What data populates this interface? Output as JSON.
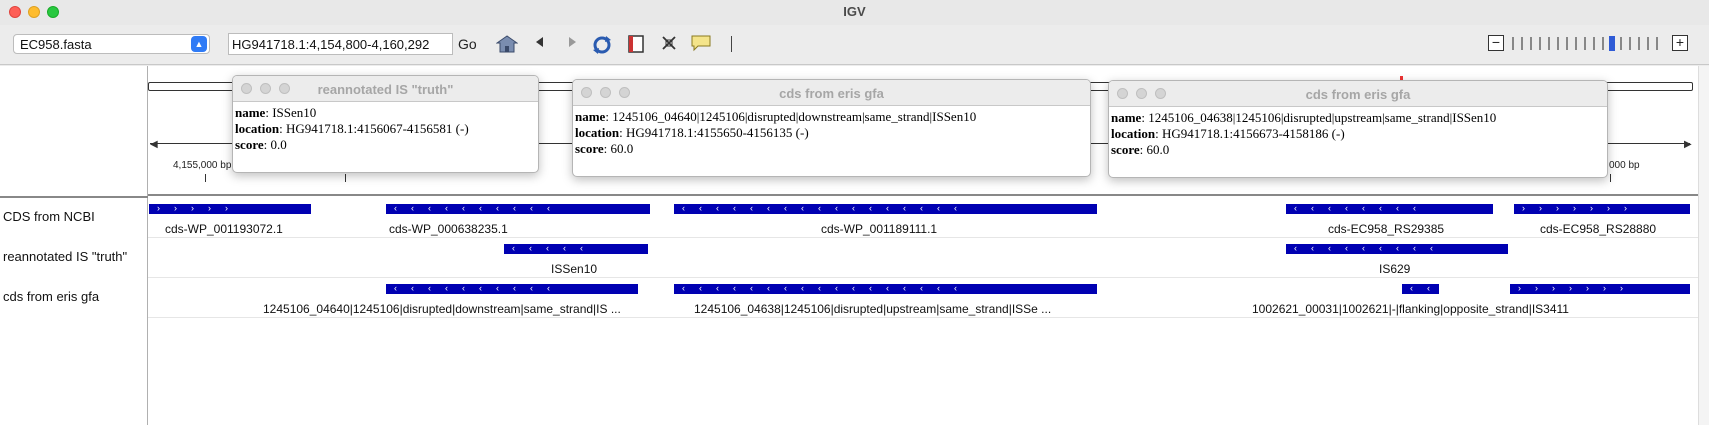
{
  "window": {
    "title": "IGV"
  },
  "toolbar": {
    "genome": "EC958.fasta",
    "locus": "HG941718.1:4,154,800-4,160,292",
    "go_label": "Go",
    "icons": [
      "home-icon",
      "back-icon",
      "forward-icon",
      "refresh-icon",
      "ruler-icon",
      "resize-icon",
      "popup-text-icon"
    ]
  },
  "ruler": {
    "left_label": "4,155,000 bp",
    "right_label": "000 bp"
  },
  "tracks": [
    {
      "name": "CDS from NCBI",
      "labels": [
        "cds-WP_001193072.1",
        "cds-WP_000638235.1",
        "cds-WP_001189111.1",
        "cds-EC958_RS29385",
        "cds-EC958_RS28880"
      ]
    },
    {
      "name": "reannotated IS \"truth\"",
      "labels": [
        "ISSen10",
        "IS629"
      ]
    },
    {
      "name": "cds from eris gfa",
      "labels": [
        "1245106_04640|1245106|disrupted|downstream|same_strand|IS ...",
        "1245106_04638|1245106|disrupted|upstream|same_strand|ISSe ...",
        "1002621_00031|1002621|-|flanking|opposite_strand|IS3411"
      ]
    }
  ],
  "popups": [
    {
      "title": "reannotated IS \"truth\"",
      "fields": [
        {
          "key": "name",
          "value": "ISSen10"
        },
        {
          "key": "location",
          "value": "HG941718.1:4156067-4156581 (-)"
        },
        {
          "key": "score",
          "value": "0.0"
        }
      ]
    },
    {
      "title": "cds from eris gfa",
      "fields": [
        {
          "key": "name",
          "value": "1245106_04640|1245106|disrupted|downstream|same_strand|ISSen10"
        },
        {
          "key": "location",
          "value": "HG941718.1:4155650-4156135 (-)"
        },
        {
          "key": "score",
          "value": "60.0"
        }
      ]
    },
    {
      "title": "cds from eris gfa",
      "fields": [
        {
          "key": "name",
          "value": "1245106_04638|1245106|disrupted|upstream|same_strand|ISSen10"
        },
        {
          "key": "location",
          "value": "HG941718.1:4156673-4158186 (-)"
        },
        {
          "key": "score",
          "value": "60.0"
        }
      ]
    }
  ],
  "colors": {
    "feature": "#0000b2",
    "accent": "#2f7bf6"
  }
}
